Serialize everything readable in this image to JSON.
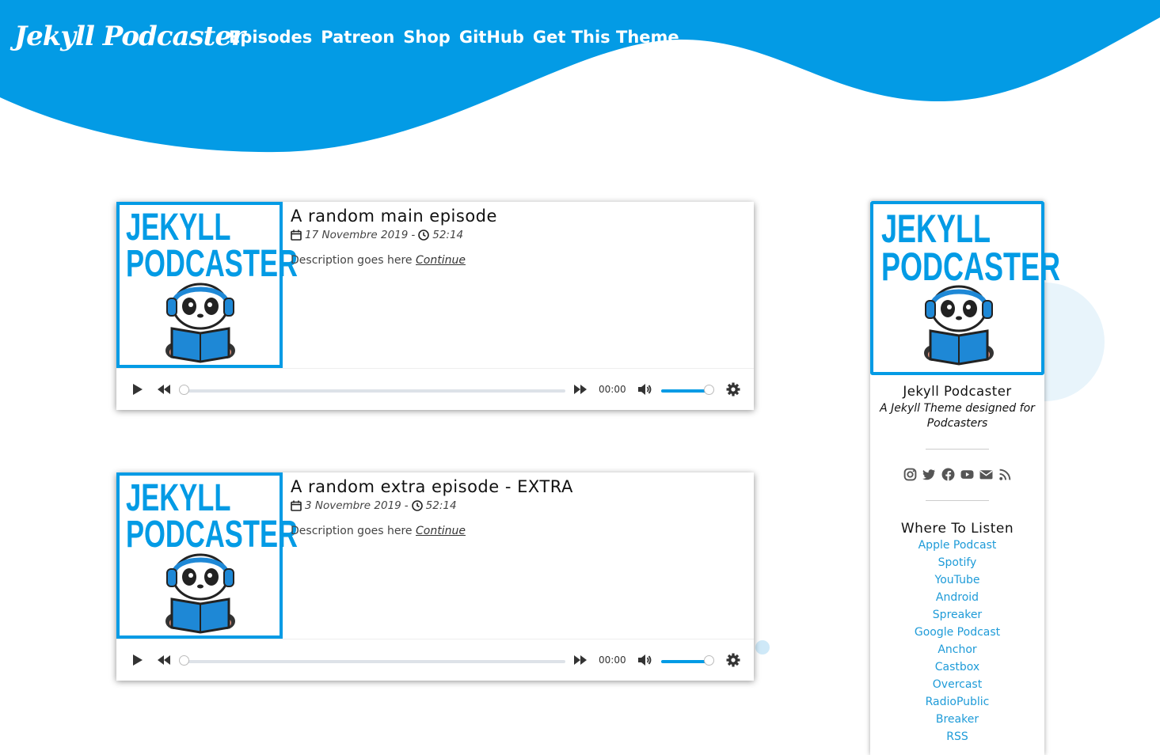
{
  "header": {
    "brand": "Jekyll Podcaster",
    "nav": [
      "Episodes",
      "Patreon",
      "Shop",
      "GitHub",
      "Get This Theme"
    ]
  },
  "colors": {
    "accent": "#039be5",
    "link": "#1e9bd8"
  },
  "cover_art": {
    "line1": "JEKYLL",
    "line2": "PODCASTER"
  },
  "episodes": [
    {
      "title": "A random main episode",
      "date": "17 Novembre 2019",
      "separator": "-",
      "duration": "52:14",
      "description": "Description goes here",
      "continue": "Continue",
      "player": {
        "time": "00:00",
        "progress": 0,
        "volume": 1
      }
    },
    {
      "title": "A random extra episode - EXTRA",
      "date": "3 Novembre 2019",
      "separator": "-",
      "duration": "52:14",
      "description": "Description goes here",
      "continue": "Continue",
      "player": {
        "time": "00:00",
        "progress": 0,
        "volume": 1
      }
    }
  ],
  "sidebar": {
    "name": "Jekyll Podcaster",
    "tagline": "A Jekyll Theme designed for Podcasters",
    "social_icons": [
      "instagram-icon",
      "twitter-icon",
      "facebook-icon",
      "youtube-icon",
      "email-icon",
      "rss-icon"
    ],
    "listen_title": "Where To Listen",
    "listen_links": [
      "Apple Podcast",
      "Spotify",
      "YouTube",
      "Android",
      "Spreaker",
      "Google Podcast",
      "Anchor",
      "Castbox",
      "Overcast",
      "RadioPublic",
      "Breaker",
      "RSS"
    ]
  }
}
